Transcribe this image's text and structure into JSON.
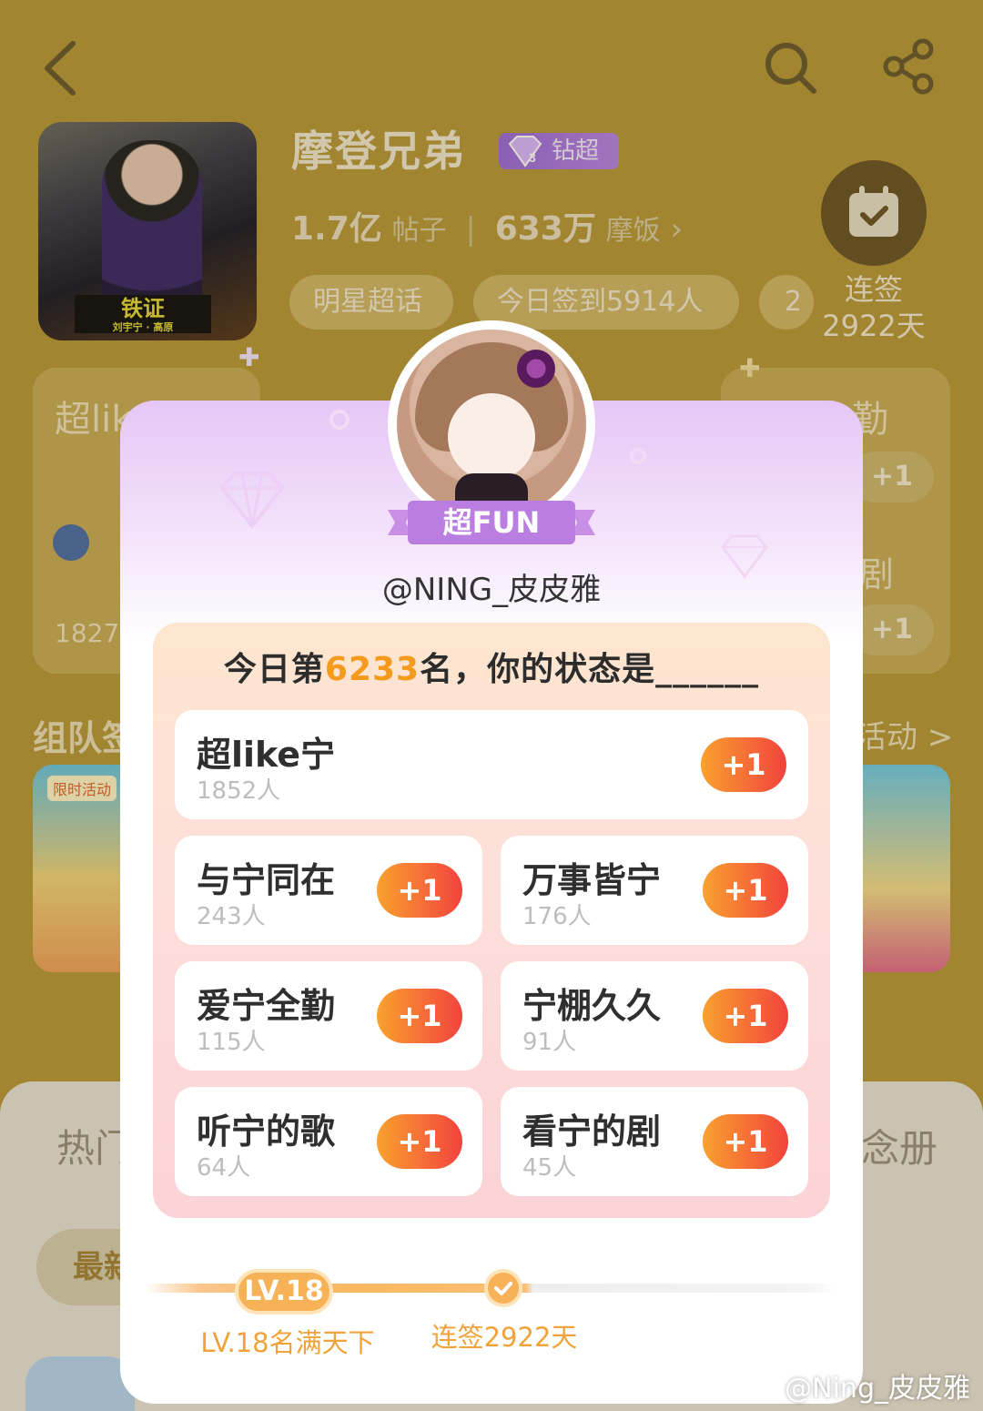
{
  "header": {
    "topic_title": "摩登兄弟",
    "badge_label": "钻超",
    "cover_tag": "铁证",
    "cover_sub": "刘宇宁 · 高原",
    "posts_count": "1.7亿",
    "posts_label": "帖子",
    "fans_count": "633万",
    "fans_label": "摩饭",
    "tags": [
      "明星超话",
      "今日签到5914人",
      "2"
    ],
    "checkin_label_line1": "连签",
    "checkin_label_line2": "2922天"
  },
  "background": {
    "card1_title": "超like宁",
    "card2_title": "与宁同在",
    "card3_title": "万事皆宁",
    "card4_title": "爱宁全勤",
    "card_right_text": "剧",
    "card1_count": "1827人",
    "plus": "+1",
    "team_label": "组队签",
    "activity_link": "活动 >",
    "promo_tag": "限时活动",
    "sheet_left": "热门",
    "sheet_right": "念册",
    "latest_chip": "最新"
  },
  "modal": {
    "ribbon": "超FUN",
    "username": "@NING_皮皮雅",
    "rank_prefix": "今日第",
    "rank_number": "6233",
    "rank_suffix": "名，你的状态是______",
    "options": [
      {
        "name": "超like宁",
        "count": "1852人"
      },
      {
        "name": "与宁同在",
        "count": "243人"
      },
      {
        "name": "万事皆宁",
        "count": "176人"
      },
      {
        "name": "爱宁全勤",
        "count": "115人"
      },
      {
        "name": "宁棚久久",
        "count": "91人"
      },
      {
        "name": "听宁的歌",
        "count": "64人"
      },
      {
        "name": "看宁的剧",
        "count": "45人"
      }
    ],
    "plus_label": "+1",
    "level_pill": "LV.18",
    "level_caption": "LV.18名满天下",
    "streak_caption": "连签2922天"
  },
  "watermark": "@Ning_皮皮雅",
  "colors": {
    "accent_orange": "#f59a1d",
    "plus_gradient_start": "#f9a12f",
    "plus_gradient_end": "#f2433d",
    "badge_purple": "#9c6bd8",
    "background_gold": "#b8993a"
  }
}
